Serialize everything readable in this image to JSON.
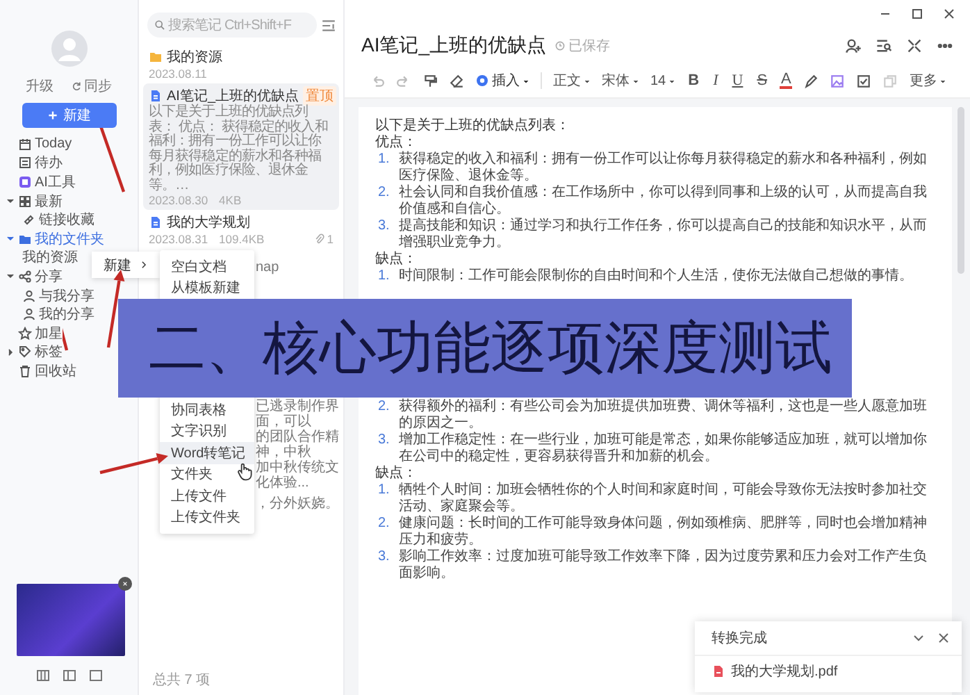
{
  "sidebar": {
    "upgrade": "升级",
    "sync": "同步",
    "new_button": "新建",
    "items": [
      {
        "label": "Today",
        "selected": false
      },
      {
        "label": "待办",
        "selected": false
      },
      {
        "label": "AI工具",
        "selected": false
      },
      {
        "label": "最新",
        "expanded": true,
        "selected": false,
        "children": [
          {
            "label": "链接收藏",
            "selected": false
          }
        ]
      },
      {
        "label": "我的文件夹",
        "expanded": true,
        "selected": true,
        "children": [
          {
            "label": "我的资源",
            "selected": false
          }
        ]
      },
      {
        "label": "分享",
        "expanded": true,
        "selected": false,
        "children": [
          {
            "label": "与我分享",
            "selected": false
          },
          {
            "label": "我的分享",
            "selected": false
          }
        ]
      },
      {
        "label": "加星",
        "selected": false
      },
      {
        "label": "标签",
        "expanded": false,
        "selected": false
      },
      {
        "label": "回收站",
        "selected": false
      }
    ]
  },
  "note_list": {
    "search": {
      "placeholder": "搜索笔记 Ctrl+Shift+F"
    },
    "items": [
      {
        "kind": "folder",
        "title": "我的资源",
        "meta": [
          "2023.08.11"
        ],
        "selected": false
      },
      {
        "kind": "note",
        "title": "AI笔记_上班的优缺点",
        "badge": "置顶",
        "preview": "以下是关于上班的优缺点列表： 优点： 获得稳定的收入和福利：拥有一份工作可以让你每月获得稳定的薪水和各种福利，例如医疗保险、退休金等。…",
        "meta": [
          "2023.08.30",
          "4KB"
        ],
        "selected": true
      },
      {
        "kind": "note",
        "title": "我的大学规划",
        "meta": [
          "2023.08.31",
          "109.4KB"
        ],
        "attachments": "1",
        "selected": false
      },
      {
        "kind": "fragment",
        "lines": [
          "nap"
        ],
        "selected": false
      },
      {
        "kind": "fragment",
        "lines": [
          "已逃录制作界面，可以",
          "的团队合作精神，中秋",
          "加中秋传统文化体验..."
        ],
        "selected": false
      },
      {
        "kind": "fragment",
        "lines": [
          "，分外妖娆。"
        ],
        "selected": false
      }
    ],
    "total": "总共 7 项"
  },
  "editor": {
    "title": "AI笔记_上班的优缺点",
    "save_status": "已保存",
    "toolbar": {
      "insert": "插入",
      "paragraph_style": "正文",
      "font": "宋体",
      "font_size": "14",
      "bold": "B",
      "italic": "I",
      "underline": "U",
      "strike": "S",
      "font_color": "A",
      "more": "更多"
    },
    "document": {
      "intro": "以下是关于上班的优缺点列表：",
      "sections": [
        {
          "heading": "优点：",
          "items": [
            {
              "number": "1.",
              "text": "获得稳定的收入和福利：拥有一份工作可以让你每月获得稳定的薪水和各种福利，例如医疗保险、退休金等。"
            },
            {
              "number": "2.",
              "text": "社会认同和自我价值感：在工作场所中，你可以得到同事和上级的认可，从而提高自我价值感和自信心。"
            },
            {
              "number": "3.",
              "text": "提高技能和知识：通过学习和执行工作任务，你可以提高自己的技能和知识水平，从而增强职业竞争力。"
            }
          ]
        },
        {
          "heading": "缺点：",
          "items": [
            {
              "number": "1.",
              "text": "时间限制：工作可能会限制你的自由时间和个人生活，使你无法做自己想做的事情。"
            }
          ]
        },
        {
          "items": [
            {
              "number": "2.",
              "text": "获得额外的福利：有些公司会为加班提供加班费、调休等福利，这也是一些人愿意加班的原因之一。"
            },
            {
              "number": "3.",
              "text": "增加工作稳定性：在一些行业，加班可能是常态，如果你能够适应加班，就可以增加你在公司中的稳定性，更容易获得晋升和加薪的机会。"
            }
          ]
        },
        {
          "heading": "缺点：",
          "items": [
            {
              "number": "1.",
              "text": "牺牲个人时间：加班会牺牲你的个人时间和家庭时间，可能会导致你无法按时参加社交活动、家庭聚会等。"
            },
            {
              "number": "2.",
              "text": "健康问题：长时间的工作可能导致身体问题，例如颈椎病、肥胖等，同时也会增加精神压力和疲劳。"
            },
            {
              "number": "3.",
              "text": "影响工作效率：过度加班可能导致工作效率下降，因为过度劳累和压力会对工作产生负面影响。"
            }
          ]
        }
      ]
    }
  },
  "context_menu": {
    "label": "新建",
    "submenu": [
      {
        "label": "空白文档",
        "selected": false
      },
      {
        "label": "从模板新建",
        "selected": false
      },
      {
        "label": "协同表格",
        "selected": false
      },
      {
        "label": "文字识别",
        "selected": false
      },
      {
        "label": "Word转笔记",
        "selected": true
      },
      {
        "label": "文件夹",
        "selected": false
      },
      {
        "label": "上传文件",
        "selected": false
      },
      {
        "label": "上传文件夹",
        "selected": false
      }
    ]
  },
  "caption_banner": "二、核心功能逐项深度测试",
  "notification": {
    "title": "转换完成",
    "file": "我的大学规划.pdf"
  }
}
